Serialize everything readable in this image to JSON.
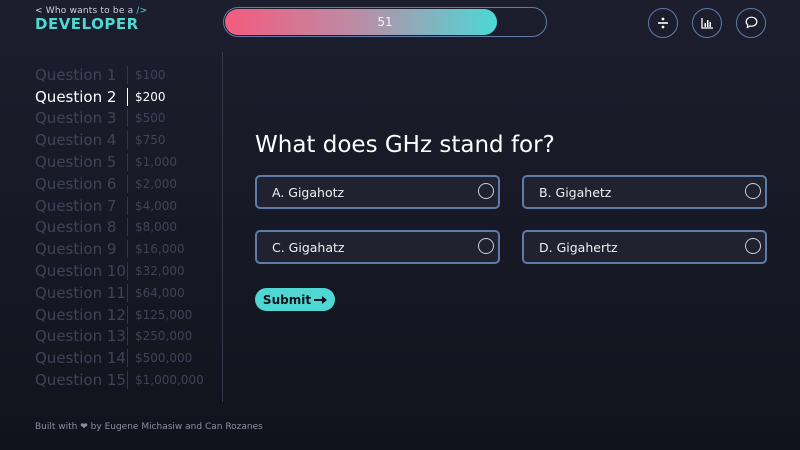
{
  "logo": {
    "subtitle_pre": "< Who wants to be a ",
    "subtitle_post": "/>",
    "title": "DEVELOPER"
  },
  "timer": {
    "value": "51",
    "fraction": 0.85
  },
  "toolbar": {
    "fifty_fifty_icon": "divide-icon",
    "audience_icon": "bar-chart-icon",
    "phone_icon": "chat-bubble-icon"
  },
  "ladder": [
    {
      "label": "Question 1",
      "amount": "$100"
    },
    {
      "label": "Question 2",
      "amount": "$200",
      "active": true
    },
    {
      "label": "Question 3",
      "amount": "$500"
    },
    {
      "label": "Question 4",
      "amount": "$750"
    },
    {
      "label": "Question 5",
      "amount": "$1,000"
    },
    {
      "label": "Question 6",
      "amount": "$2,000"
    },
    {
      "label": "Question 7",
      "amount": "$4,000"
    },
    {
      "label": "Question 8",
      "amount": "$8,000"
    },
    {
      "label": "Question 9",
      "amount": "$16,000"
    },
    {
      "label": "Question 10",
      "amount": "$32,000"
    },
    {
      "label": "Question 11",
      "amount": "$64,000"
    },
    {
      "label": "Question 12",
      "amount": "$125,000"
    },
    {
      "label": "Question 13",
      "amount": "$250,000"
    },
    {
      "label": "Question 14",
      "amount": "$500,000"
    },
    {
      "label": "Question 15",
      "amount": "$1,000,000"
    }
  ],
  "question": {
    "text": "What does GHz stand for?"
  },
  "answers": [
    {
      "label": "A. Gigahotz"
    },
    {
      "label": "B. Gigahetz"
    },
    {
      "label": "C. Gigahatz"
    },
    {
      "label": "D. Gigahertz"
    }
  ],
  "submit": {
    "label": "Submit"
  },
  "footer": {
    "pre": "Built with",
    "post": "by Eugene Michasiw and Can Rozanes"
  },
  "colors": {
    "accent": "#4fd8d3",
    "border": "#5f7ba8",
    "pink": "#f55b7f"
  }
}
